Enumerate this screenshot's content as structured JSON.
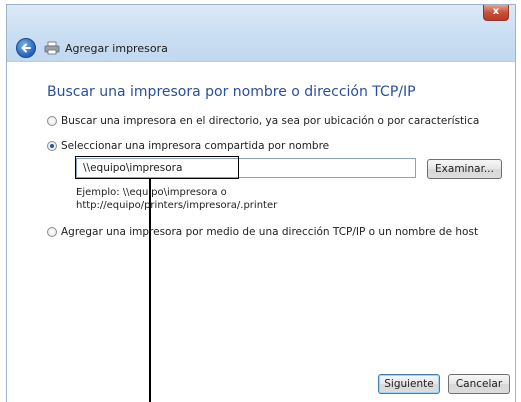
{
  "window": {
    "title": "Agregar impresora",
    "close_label": "x"
  },
  "main": {
    "heading": "Buscar una impresora por nombre o dirección TCP/IP",
    "options": [
      {
        "label": "Buscar una impresora en el directorio, ya sea por ubicación o por característica",
        "selected": false
      },
      {
        "label": "Seleccionar una impresora compartida por nombre",
        "selected": true
      },
      {
        "label": "Agregar una impresora por medio de una dirección TCP/IP o un nombre de host",
        "selected": false
      }
    ],
    "printer_path": {
      "value": "\\\\equipo\\impresora"
    },
    "browse_button": "Examinar...",
    "example_line1": "Ejemplo: \\\\equipo\\impresora o",
    "example_line2": "http://equipo/printers/impresora/.printer"
  },
  "footer": {
    "next_button": "Siguiente",
    "cancel_button": "Cancelar"
  },
  "icons": {
    "back": "back-arrow-icon",
    "printer": "printer-icon",
    "close": "close-icon"
  },
  "colors": {
    "heading": "#2a4f9c",
    "titlebar": "#c9def2",
    "close": "#c9503b"
  }
}
